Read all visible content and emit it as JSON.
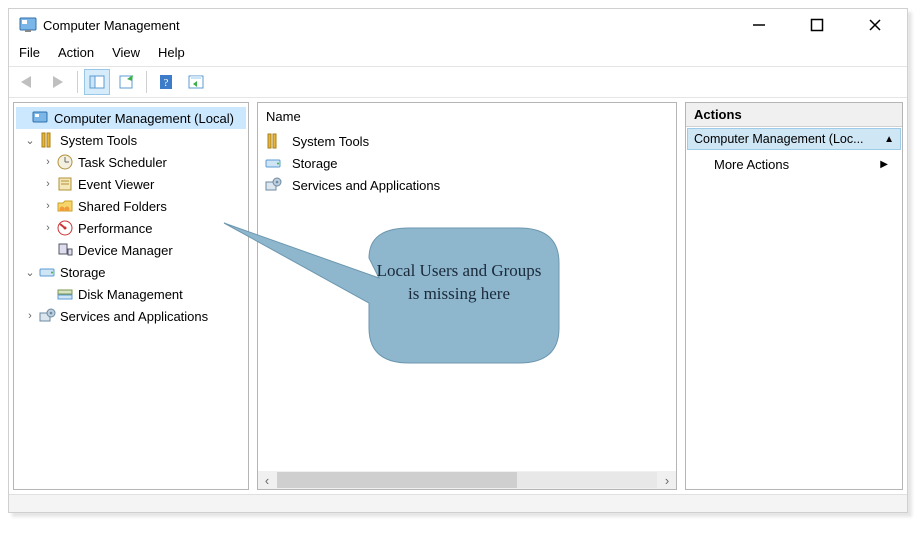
{
  "window": {
    "title": "Computer Management"
  },
  "menu": {
    "file": "File",
    "action": "Action",
    "view": "View",
    "help": "Help"
  },
  "tree": {
    "root": "Computer Management (Local)",
    "system_tools": "System Tools",
    "task_scheduler": "Task Scheduler",
    "event_viewer": "Event Viewer",
    "shared_folders": "Shared Folders",
    "performance": "Performance",
    "device_manager": "Device Manager",
    "storage": "Storage",
    "disk_management": "Disk Management",
    "services_apps": "Services and Applications"
  },
  "list": {
    "header_name": "Name",
    "items": {
      "system_tools": "System Tools",
      "storage": "Storage",
      "services_apps": "Services and Applications"
    }
  },
  "actions": {
    "header": "Actions",
    "selected": "Computer Management (Loc...",
    "more": "More Actions"
  },
  "callout": {
    "text": "Local Users and Groups is missing here"
  }
}
